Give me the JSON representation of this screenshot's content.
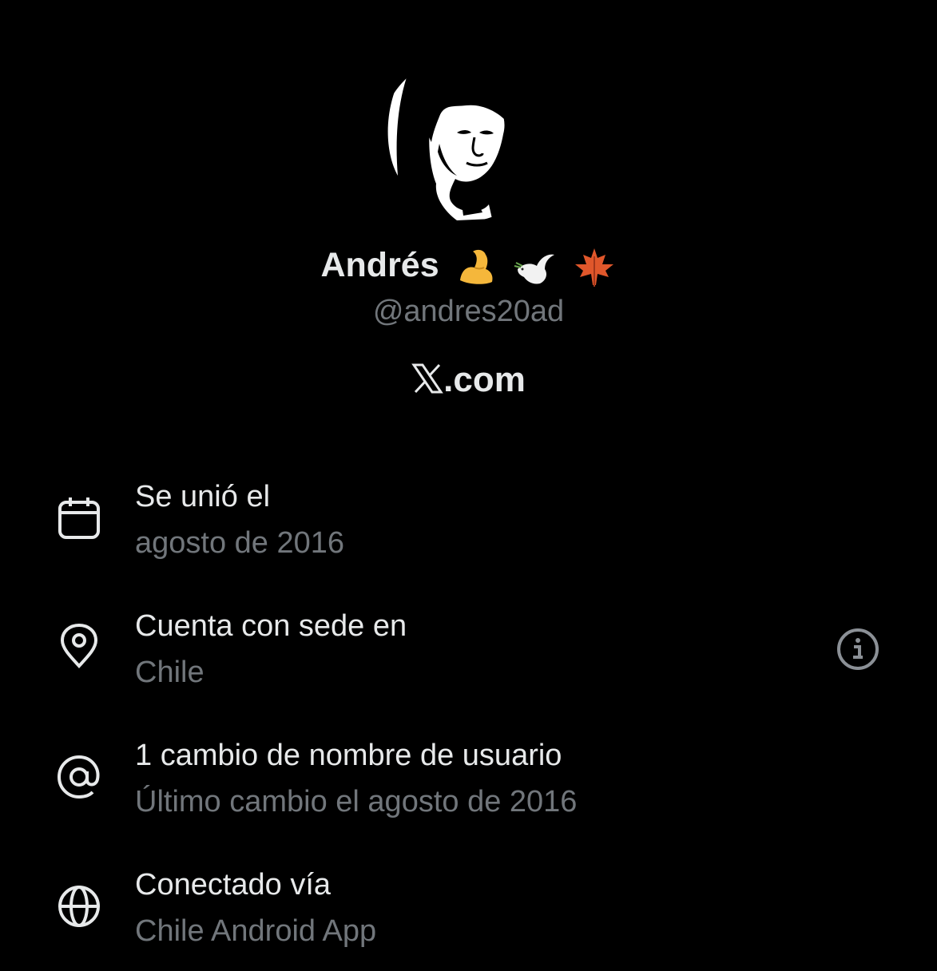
{
  "profile": {
    "display_name": "Andrés",
    "name_emojis": [
      "flexed-biceps",
      "dove",
      "maple-leaf"
    ],
    "handle": "@andres20ad",
    "domain_suffix": ".com"
  },
  "details": [
    {
      "icon": "calendar-icon",
      "title": "Se unió el",
      "value": "agosto de 2016"
    },
    {
      "icon": "location-pin-icon",
      "title": "Cuenta con sede en",
      "value": "Chile"
    },
    {
      "icon": "at-sign-icon",
      "title": "1 cambio de nombre de usuario",
      "value": "Último cambio el agosto de 2016"
    },
    {
      "icon": "globe-icon",
      "title": "Conectado vía",
      "value": "Chile Android App"
    }
  ],
  "colors": {
    "background": "#000000",
    "primary_text": "#e7e9ea",
    "secondary_text": "#71767b"
  }
}
